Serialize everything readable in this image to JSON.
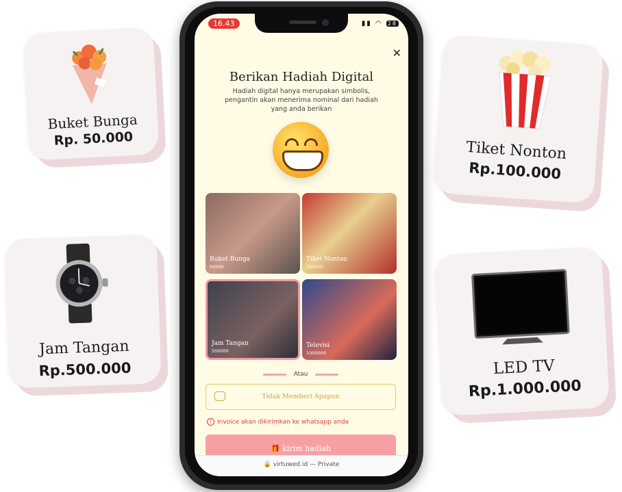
{
  "cards": [
    {
      "name": "Buket Bunga",
      "price": "Rp. 50.000",
      "icon": "flower-bouquet-icon"
    },
    {
      "name": "Tiket Nonton",
      "price": "Rp.100.000",
      "icon": "popcorn-icon"
    },
    {
      "name": "Jam Tangan",
      "price": "Rp.500.000",
      "icon": "wristwatch-icon"
    },
    {
      "name": "LED TV",
      "price": "Rp.1.000.000",
      "icon": "tv-icon"
    }
  ],
  "status_bar": {
    "time": "16.43",
    "battery": "28"
  },
  "modal": {
    "title": "Berikan Hadiah Digital",
    "subtitle": "Hadiah digital hanya merupakan simbolis, pengantin akan menerima nominal dari hadiah yang anda berikan",
    "gifts": [
      {
        "label": "Buket Bunga",
        "value": "50000"
      },
      {
        "label": "Tiket Nonton",
        "value": "100000"
      },
      {
        "label": "Jam Tangan",
        "value": "500000"
      },
      {
        "label": "Televisi",
        "value": "1000000"
      }
    ],
    "divider_text": "Atau",
    "no_gift_label": "Tidak Memberi Apapun",
    "invoice_note": "Invoice akan dikirimkan ke whatsapp anda",
    "send_label": "kirim hadiah"
  },
  "browser": {
    "url": "virtuwed.id — Private"
  },
  "colors": {
    "accent": "#f7a0a3",
    "gold": "#caa64a",
    "error": "#e23c3c",
    "screen_bg": "#fffbe5"
  }
}
